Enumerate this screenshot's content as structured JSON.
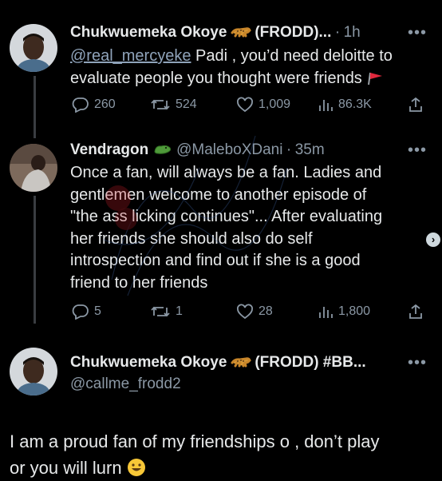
{
  "tweet1": {
    "display_name": "Chukwuemeka Okoye",
    "name_suffix": "(FRODD)...",
    "separator": "·",
    "time": "1h",
    "mention": "@real_mercyeke",
    "text_line1_rest": "Padi , you’d need deloitte to",
    "text_line2": "evaluate people you thought were friends",
    "replies": "260",
    "retweets": "524",
    "likes": "1,009",
    "views": "86.3K"
  },
  "tweet2": {
    "display_name": "Vendragon",
    "handle": "@MaleboXDani",
    "separator": "·",
    "time": "35m",
    "lines": [
      "Once a fan, will always be a fan. Ladies and",
      "gentlemen welcome to another episode of",
      "\"the ass licking continues\"... After evaluating",
      "her friends she should also do self",
      "introspection and find out if she is a good",
      "friend to her friends"
    ],
    "replies": "5",
    "retweets": "1",
    "likes": "28",
    "views": "1,800"
  },
  "tweet3": {
    "display_name": "Chukwuemeka Okoye",
    "name_suffix": "(FRODD) #BB...",
    "handle": "@callme_frodd2",
    "text_line1": "I am a proud fan of my friendships o , don’t play",
    "text_line2": "or you will lurn"
  },
  "icons": {
    "leopard": "leopard-emoji",
    "crocodile": "crocodile-emoji",
    "flag": "red-flag-emoji",
    "grin": "grinning-face-emoji",
    "more": "more-dots-icon",
    "scroll": "scroll-right-chevron-icon"
  },
  "colors": {
    "background": "#000000",
    "text": "#e7e9ea",
    "muted": "#8b98a5",
    "mention": "#8fa3ba"
  }
}
